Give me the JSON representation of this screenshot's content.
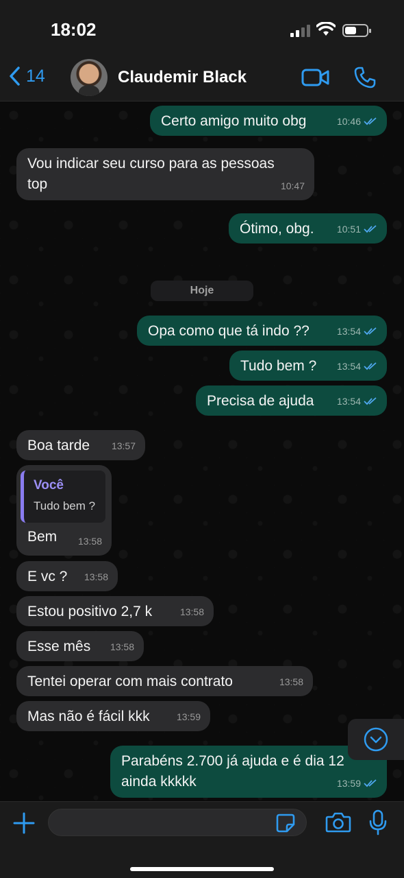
{
  "status_bar": {
    "time": "18:02"
  },
  "header": {
    "back_count": "14",
    "contact_name": "Claudemir Black"
  },
  "date_separator": "Hoje",
  "messages": [
    {
      "text": "Certo amigo muito obg",
      "time": "10:46"
    },
    {
      "text": "Vou indicar seu curso para as pessoas\ntop",
      "time": "10:47"
    },
    {
      "text": "Ótimo, obg.",
      "time": "10:51"
    },
    {
      "text": "Opa como que tá indo ??",
      "time": "13:54"
    },
    {
      "text": "Tudo bem ?",
      "time": "13:54"
    },
    {
      "text": "Precisa de ajuda",
      "time": "13:54"
    },
    {
      "text": "Boa tarde",
      "time": "13:57"
    },
    {
      "text": "Bem",
      "time": "13:58",
      "quote_author": "Você",
      "quote_text": "Tudo bem ?"
    },
    {
      "text": "E vc ?",
      "time": "13:58"
    },
    {
      "text": "Estou positivo 2,7 k",
      "time": "13:58"
    },
    {
      "text": "Esse mês",
      "time": "13:58"
    },
    {
      "text": "Tentei operar com mais contrato",
      "time": "13:58"
    },
    {
      "text": "Mas não é fácil kkk",
      "time": "13:59"
    },
    {
      "text": "Parabéns 2.700 já ajuda e é dia 12\nainda kkkkk",
      "time": "13:59"
    }
  ],
  "colors": {
    "accent": "#2f9bf0",
    "outgoing_bubble": "#0d4b3f",
    "incoming_bubble": "#2c2c2e",
    "quote_accent": "#9c8ff5"
  }
}
